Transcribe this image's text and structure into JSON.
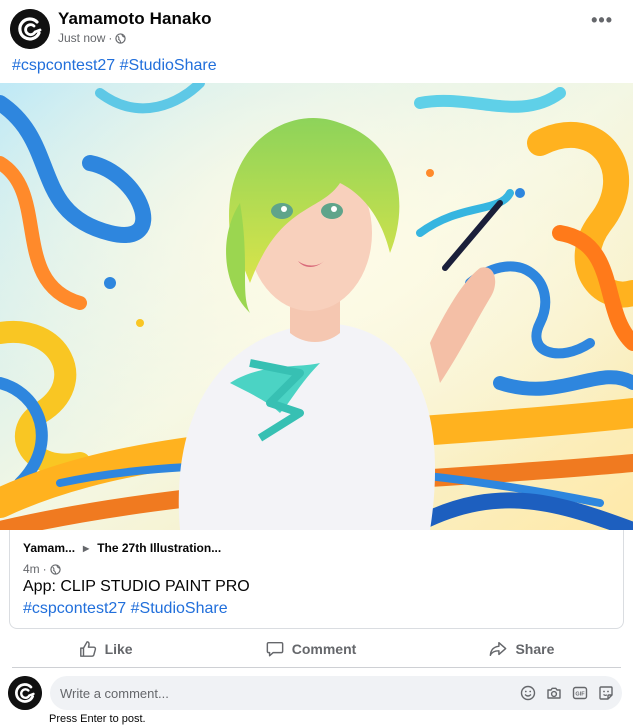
{
  "post": {
    "author": "Yamamoto Hanako",
    "timestamp": "Just now",
    "privacy_icon": "globe-icon",
    "more_label": "•••",
    "hashtags": [
      "#cspcontest27",
      "#StudioShare"
    ]
  },
  "shared_card": {
    "breadcrumb_from": "Yamam...",
    "breadcrumb_to": "The 27th Illustration...",
    "timestamp": "4m",
    "text": "App: CLIP STUDIO PAINT PRO",
    "hashtags": [
      "#cspcontest27",
      "#StudioShare"
    ]
  },
  "actions": {
    "like": "Like",
    "comment": "Comment",
    "share": "Share"
  },
  "comment": {
    "placeholder": "Write a comment...",
    "hint": "Press Enter to post.",
    "icons": [
      "emoji-icon",
      "camera-icon",
      "gif-icon",
      "sticker-icon"
    ]
  },
  "colors": {
    "link": "#216fdb",
    "secondary_text": "#65676b",
    "comment_bg": "#f0f2f5"
  }
}
